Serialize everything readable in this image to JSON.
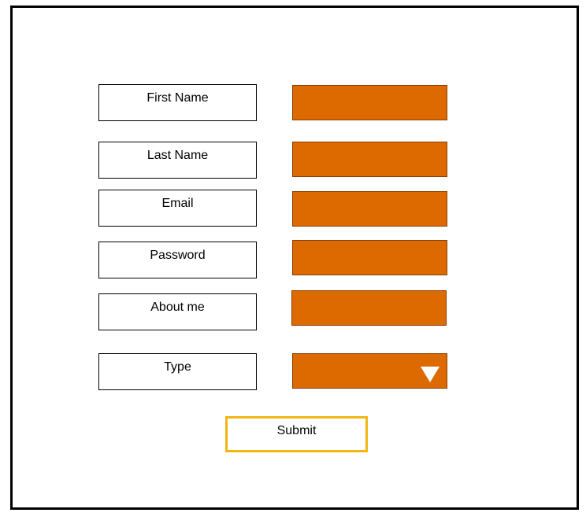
{
  "colors": {
    "field_fill": "#dd6a00",
    "submit_border": "#f2b613",
    "frame_border": "#000000"
  },
  "form": {
    "first_name_label": "First Name",
    "last_name_label": "Last Name",
    "email_label": "Email",
    "password_label": "Password",
    "about_label": "About me",
    "type_label": "Type",
    "type_dropdown_icon": "triangle-down-icon",
    "submit_label": "Submit"
  }
}
